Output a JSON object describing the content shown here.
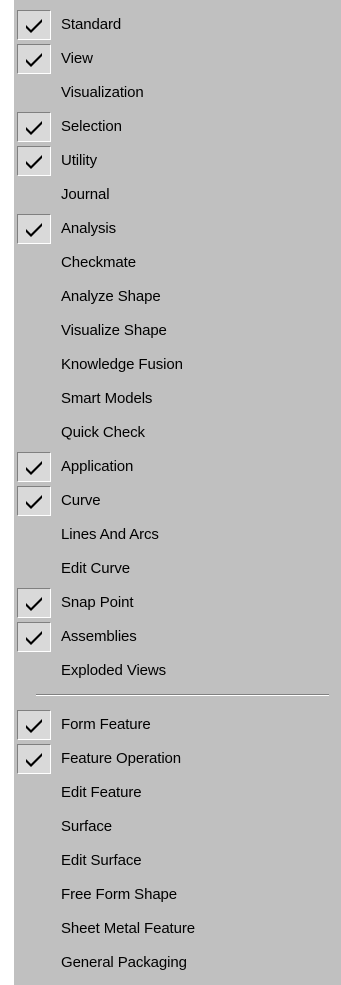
{
  "menu": {
    "groups": [
      {
        "items": [
          {
            "label": "Standard",
            "checked": true
          },
          {
            "label": "View",
            "checked": true
          },
          {
            "label": "Visualization",
            "checked": false
          },
          {
            "label": "Selection",
            "checked": true
          },
          {
            "label": "Utility",
            "checked": true
          },
          {
            "label": "Journal",
            "checked": false
          },
          {
            "label": "Analysis",
            "checked": true
          },
          {
            "label": "Checkmate",
            "checked": false
          },
          {
            "label": "Analyze Shape",
            "checked": false
          },
          {
            "label": "Visualize Shape",
            "checked": false
          },
          {
            "label": "Knowledge Fusion",
            "checked": false
          },
          {
            "label": "Smart Models",
            "checked": false
          },
          {
            "label": "Quick Check",
            "checked": false
          },
          {
            "label": "Application",
            "checked": true
          },
          {
            "label": "Curve",
            "checked": true
          },
          {
            "label": "Lines And Arcs",
            "checked": false
          },
          {
            "label": "Edit Curve",
            "checked": false
          },
          {
            "label": "Snap Point",
            "checked": true
          },
          {
            "label": "Assemblies",
            "checked": true
          },
          {
            "label": "Exploded Views",
            "checked": false
          }
        ]
      },
      {
        "items": [
          {
            "label": "Form Feature",
            "checked": true
          },
          {
            "label": "Feature Operation",
            "checked": true
          },
          {
            "label": "Edit Feature",
            "checked": false
          },
          {
            "label": "Surface",
            "checked": false
          },
          {
            "label": "Edit Surface",
            "checked": false
          },
          {
            "label": "Free Form Shape",
            "checked": false
          },
          {
            "label": "Sheet Metal Feature",
            "checked": false
          },
          {
            "label": "General Packaging",
            "checked": false
          }
        ]
      }
    ],
    "check_icon": "checkmark-icon",
    "colors": {
      "menu_bg": "#c0c0c0",
      "checked_bg": "#d9d9d9",
      "text": "#000000"
    }
  }
}
